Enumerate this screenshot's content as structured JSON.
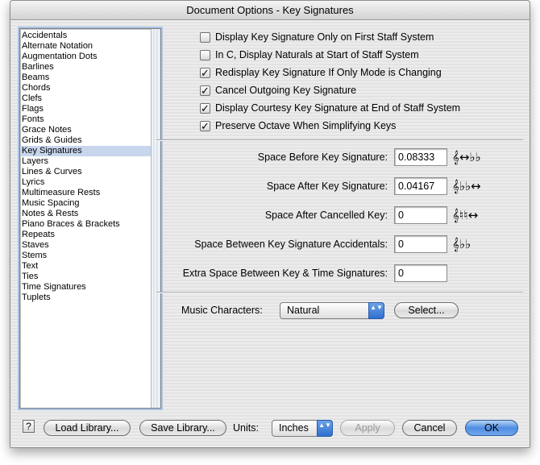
{
  "window": {
    "title": "Document Options - Key Signatures"
  },
  "categories": [
    "Accidentals",
    "Alternate Notation",
    "Augmentation Dots",
    "Barlines",
    "Beams",
    "Chords",
    "Clefs",
    "Flags",
    "Fonts",
    "Grace Notes",
    "Grids & Guides",
    "Key Signatures",
    "Layers",
    "Lines & Curves",
    "Lyrics",
    "Multimeasure Rests",
    "Music Spacing",
    "Notes & Rests",
    "Piano Braces & Brackets",
    "Repeats",
    "Staves",
    "Stems",
    "Text",
    "Ties",
    "Time Signatures",
    "Tuplets"
  ],
  "selected_category": "Key Signatures",
  "checkboxes": [
    {
      "label": "Display Key Signature Only on First Staff System",
      "checked": false
    },
    {
      "label": "In C, Display Naturals at Start of Staff System",
      "checked": false
    },
    {
      "label": "Redisplay Key Signature If Only Mode is Changing",
      "checked": true
    },
    {
      "label": "Cancel Outgoing Key Signature",
      "checked": true
    },
    {
      "label": "Display Courtesy Key Signature at End of Staff System",
      "checked": true
    },
    {
      "label": "Preserve Octave When Simplifying Keys",
      "checked": true
    }
  ],
  "check_mark": "✓",
  "fields": [
    {
      "label": "Space Before Key Signature:",
      "value": "0.08333",
      "glyph": "𝄞↔♭♭"
    },
    {
      "label": "Space After Key Signature:",
      "value": "0.04167",
      "glyph": "𝄞♭♭↔"
    },
    {
      "label": "Space After Cancelled Key:",
      "value": "0",
      "glyph": "𝄞♮♮↔"
    },
    {
      "label": "Space Between Key Signature Accidentals:",
      "value": "0",
      "glyph": "𝄞♭♭"
    },
    {
      "label": "Extra Space Between Key & Time Signatures:",
      "value": "0",
      "glyph": ""
    }
  ],
  "music_characters": {
    "label": "Music Characters:",
    "value": "Natural",
    "select_button": "Select..."
  },
  "footer": {
    "help": "?",
    "load_library": "Load Library...",
    "save_library": "Save Library...",
    "units_label": "Units:",
    "units_value": "Inches",
    "apply": "Apply",
    "cancel": "Cancel",
    "ok": "OK"
  },
  "popup_arrows": "▲▼"
}
